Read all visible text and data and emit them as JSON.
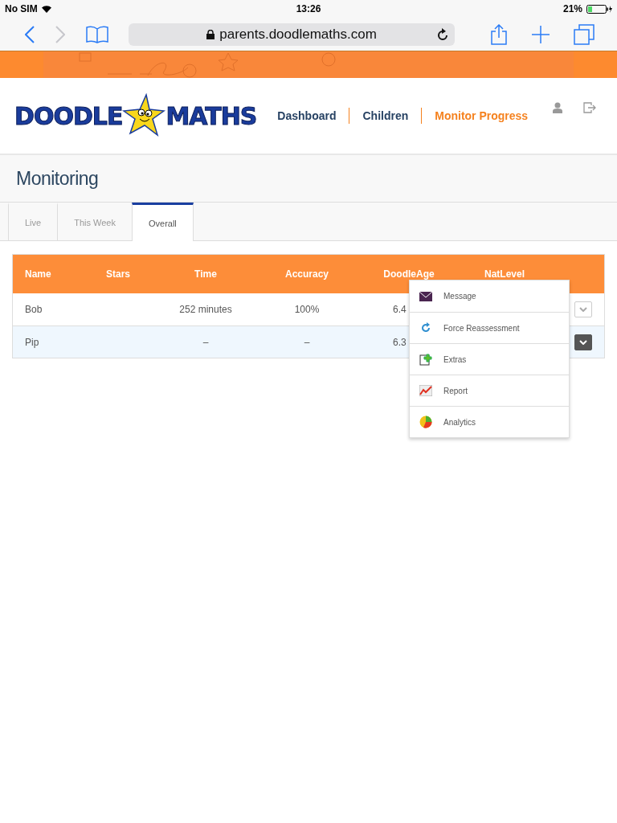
{
  "status_bar": {
    "carrier": "No SIM",
    "time": "13:26",
    "battery": "21%"
  },
  "browser": {
    "url": "parents.doodlemaths.com",
    "back_enabled": true,
    "forward_enabled": false
  },
  "logo": {
    "left": "DOODLE",
    "right": "MATHS"
  },
  "nav": [
    {
      "label": "Dashboard",
      "selected": false
    },
    {
      "label": "Children",
      "selected": false
    },
    {
      "label": "Monitor Progress",
      "selected": true
    }
  ],
  "page_title": "Monitoring",
  "tabs": [
    {
      "label": "Live",
      "selected": false
    },
    {
      "label": "This Week",
      "selected": false
    },
    {
      "label": "Overall",
      "selected": true
    }
  ],
  "table": {
    "columns": [
      "Name",
      "Stars",
      "Time",
      "Accuracy",
      "DoodleAge",
      "NatLevel"
    ],
    "rows": [
      {
        "cells": [
          "Bob",
          "",
          "252 minutes",
          "100%",
          "6.4",
          ""
        ],
        "selected": false
      },
      {
        "cells": [
          "Pip",
          "",
          "–",
          "–",
          "6.3",
          ""
        ],
        "selected": true
      }
    ]
  },
  "menu": [
    {
      "label": "Message",
      "kind": "message"
    },
    {
      "label": "Force Reassessment",
      "kind": "reassess"
    },
    {
      "label": "Extras",
      "kind": "extras"
    },
    {
      "label": "Report",
      "kind": "report"
    },
    {
      "label": "Analytics",
      "kind": "analytics"
    }
  ]
}
